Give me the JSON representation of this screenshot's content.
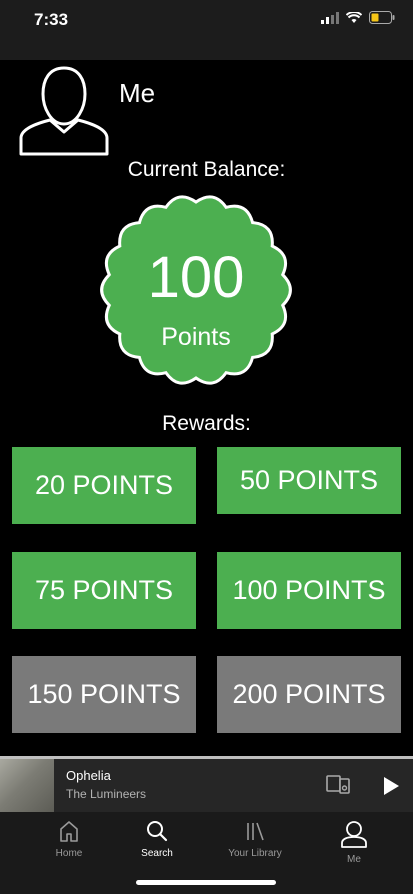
{
  "status": {
    "time": "7:33"
  },
  "profile": {
    "name": "Me"
  },
  "balance": {
    "label": "Current Balance:",
    "amount": "100",
    "unit": "Points"
  },
  "rewards": {
    "label": "Rewards:",
    "items": [
      {
        "label": "20 POINTS",
        "available": true
      },
      {
        "label": "50 POINTS",
        "available": true
      },
      {
        "label": "75 POINTS",
        "available": true
      },
      {
        "label": "100 POINTS",
        "available": true
      },
      {
        "label": "150 POINTS",
        "available": false
      },
      {
        "label": "200 POINTS",
        "available": false
      }
    ]
  },
  "now_playing": {
    "title": "Ophelia",
    "artist": "The Lumineers"
  },
  "tabs": [
    {
      "label": "Home",
      "icon": "home-icon"
    },
    {
      "label": "Search",
      "icon": "search-icon"
    },
    {
      "label": "Your Library",
      "icon": "library-icon"
    },
    {
      "label": "Me",
      "icon": "profile-icon"
    }
  ],
  "colors": {
    "green": "#4caf50",
    "grey": "#7a7a7a",
    "background": "#000000"
  }
}
